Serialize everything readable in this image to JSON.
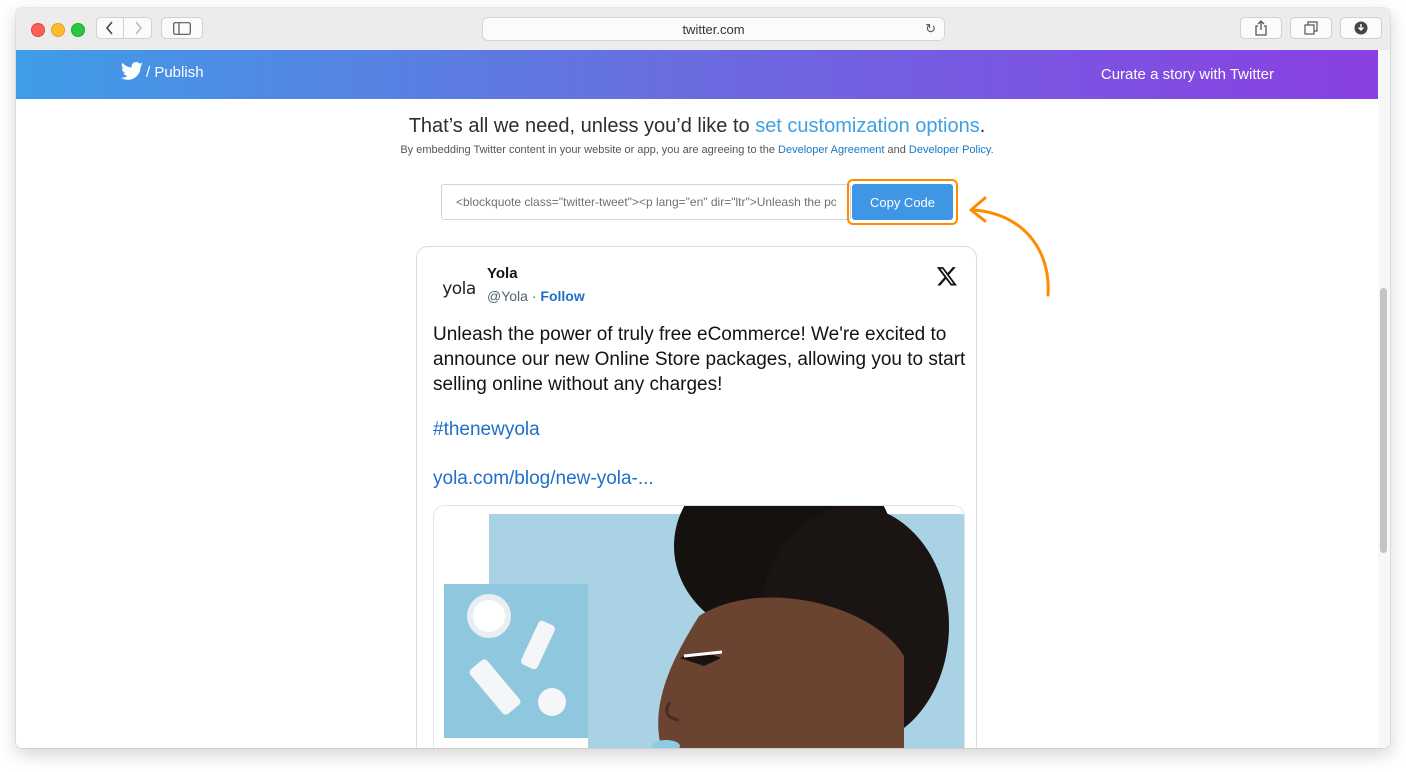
{
  "browser": {
    "url": "twitter.com"
  },
  "header": {
    "brand_label": "/ Publish",
    "right_link": "Curate a story with Twitter"
  },
  "intro": {
    "headline_prefix": "That’s all we need, unless you’d like to ",
    "headline_link": "set customization options",
    "headline_suffix": ".",
    "notice_prefix": "By embedding Twitter content in your website or app, you are agreeing to the ",
    "notice_link1": "Developer Agreement",
    "notice_mid": " and ",
    "notice_link2": "Developer Policy",
    "notice_suffix": "."
  },
  "embed": {
    "code_value": "<blockquote class=\"twitter-tweet\"><p lang=\"en\" dir=\"ltr\">Unleash the power of truly free eCommerce!",
    "copy_label": "Copy Code"
  },
  "tweet": {
    "avatar_text": "yola",
    "name": "Yola",
    "handle": "@Yola · ",
    "follow_label": "Follow",
    "text": "Unleash the power of truly free eCommerce! We're excited to announce our new Online Store packages, allowing you to start selling online without any charges!",
    "hashtag": "#thenewyola",
    "link": "yola.com/blog/new-yola-..."
  },
  "colors": {
    "accent_orange": "#ff8b00",
    "copy_button": "#3f96e5",
    "link_blue": "#1d70c8"
  }
}
